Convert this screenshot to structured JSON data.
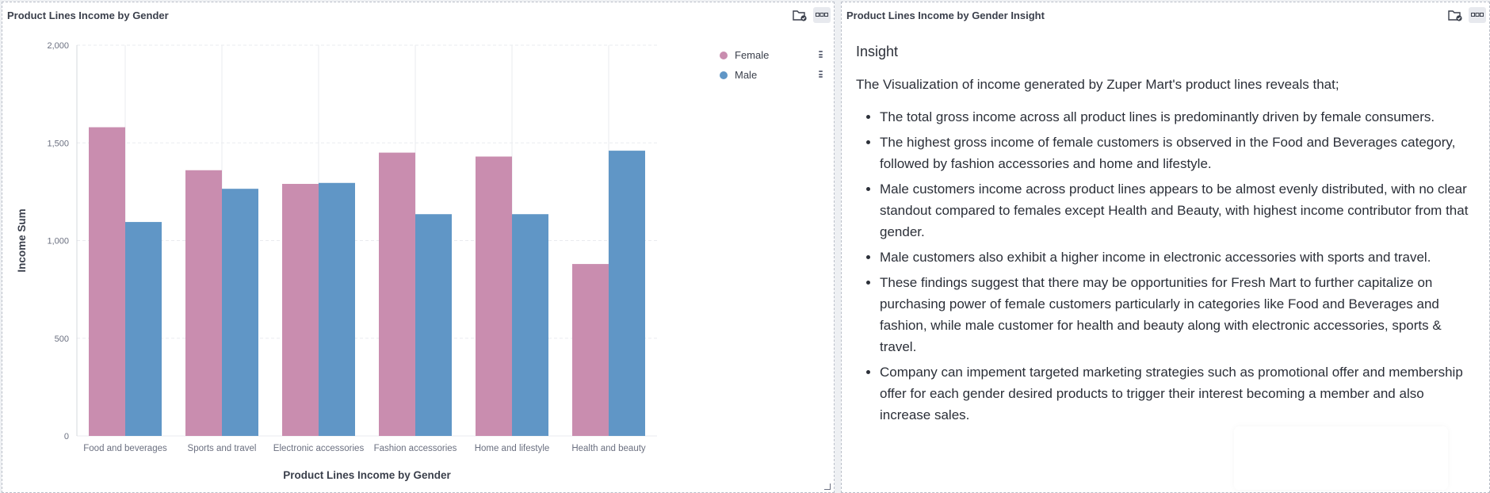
{
  "left_panel": {
    "title": "Product Lines Income by Gender",
    "icons": [
      "folder-check-icon",
      "more-icon"
    ]
  },
  "right_panel": {
    "title": "Product Lines Income by Gender Insight",
    "icons": [
      "folder-check-icon",
      "more-icon"
    ]
  },
  "colors": {
    "female": "#c98daf",
    "male": "#6096c6",
    "grid": "#e9ebef",
    "axis_text": "#6b7080"
  },
  "legend": {
    "items": [
      {
        "label": "Female",
        "color": "#c98daf"
      },
      {
        "label": "Male",
        "color": "#6096c6"
      }
    ]
  },
  "chart_data": {
    "type": "bar",
    "categories": [
      "Food and beverages",
      "Sports and travel",
      "Electronic accessories",
      "Fashion accessories",
      "Home and lifestyle",
      "Health and beauty"
    ],
    "series": [
      {
        "name": "Female",
        "values": [
          1580,
          1360,
          1290,
          1450,
          1430,
          880
        ]
      },
      {
        "name": "Male",
        "values": [
          1095,
          1265,
          1295,
          1135,
          1135,
          1460
        ]
      }
    ],
    "yticks": [
      "0",
      "500",
      "1,000",
      "1,500",
      "2,000"
    ],
    "xlabel": "Product Lines Income by Gender",
    "ylabel": "Income Sum",
    "ylim": [
      0,
      2000
    ],
    "grid": true,
    "legend_position": "top-right"
  },
  "insight": {
    "heading": "Insight",
    "intro": "The Visualization of income generated by Zuper Mart's product lines reveals that;",
    "bullets": [
      "The total gross income across all product lines is predominantly driven by female consumers.",
      "The highest gross income of female customers is observed in the Food and Beverages category, followed by fashion accessories and home and lifestyle.",
      "Male customers income across product lines appears to be almost evenly distributed, with no clear standout compared to females except Health and Beauty, with highest income contributor from that gender.",
      "Male customers also exhibit a higher income in electronic accessories with sports and travel.",
      "These findings suggest that there may be opportunities for Fresh Mart to further capitalize on purchasing power of female customers particularly in categories like Food and Beverages and fashion, while male customer for health and beauty along with electronic accessories, sports & travel.",
      "Company can impement targeted marketing strategies such as promotional offer and membership offer for each gender desired products to trigger their interest becoming a member and also increase sales."
    ]
  }
}
